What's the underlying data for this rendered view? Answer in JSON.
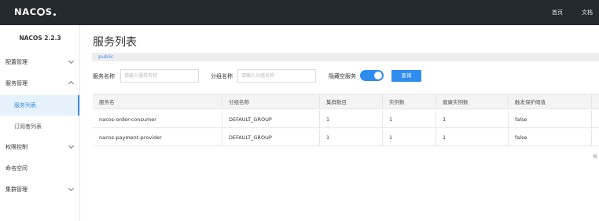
{
  "header": {
    "logo_text_left": "N",
    "logo_text_right": "C",
    "logo_text_tail": "S",
    "nav": [
      "首页",
      "文档"
    ]
  },
  "sidebar": {
    "version": "NACOS 2.2.3",
    "items": [
      {
        "label": "配置管理",
        "expandable": true
      },
      {
        "label": "服务管理",
        "expandable": true
      },
      {
        "label": "服务列表",
        "sub": true,
        "active": true
      },
      {
        "label": "订阅者列表",
        "sub": true
      },
      {
        "label": "权限控制",
        "expandable": true
      },
      {
        "label": "命名空间"
      },
      {
        "label": "集群管理",
        "expandable": true
      }
    ]
  },
  "main": {
    "title": "服务列表",
    "namespace": "public",
    "filters": {
      "service_name_label": "服务名称",
      "service_name_placeholder": "请输入服务名称",
      "group_name_label": "分组名称",
      "group_name_placeholder": "请输入分组名称",
      "hide_empty_label": "隐藏空服务",
      "hide_empty_on": true,
      "query_button": "查询"
    },
    "table": {
      "columns": [
        "服务名",
        "分组名称",
        "集群数目",
        "实例数",
        "健康实例数",
        "触发保护阈值"
      ],
      "rows": [
        [
          "nacos-order-consumer",
          "DEFAULT_GROUP",
          "1",
          "1",
          "1",
          "false"
        ],
        [
          "nacos-payment-provider",
          "DEFAULT_GROUP",
          "1",
          "1",
          "1",
          "false"
        ]
      ]
    },
    "pager_note": "每"
  },
  "colors": {
    "topbar": "#252a2f",
    "accent": "#2f8cf0",
    "active_bg": "#e6f2fb"
  }
}
